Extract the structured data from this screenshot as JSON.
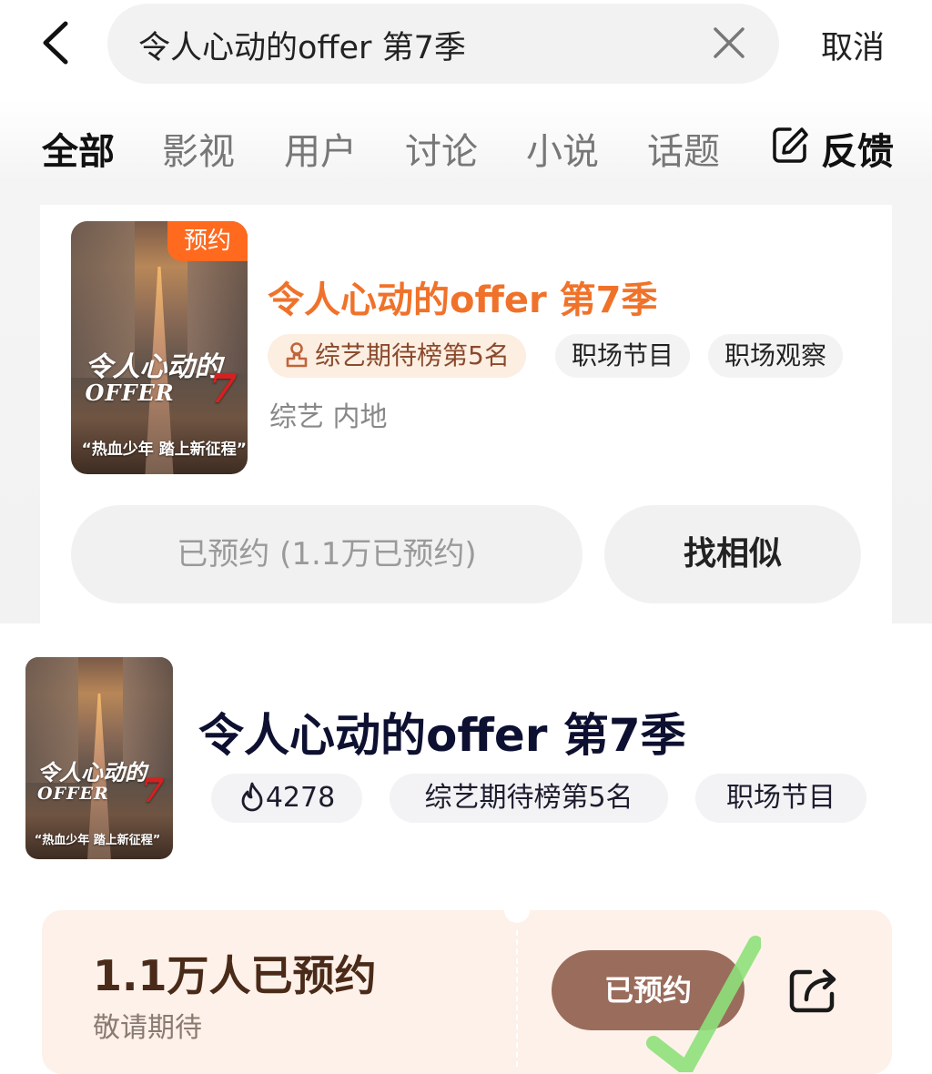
{
  "search": {
    "query": "令人心动的offer 第7季",
    "cancel_label": "取消"
  },
  "tabs": [
    {
      "label": "全部",
      "active": true
    },
    {
      "label": "影视"
    },
    {
      "label": "用户"
    },
    {
      "label": "讨论"
    },
    {
      "label": "小说"
    },
    {
      "label": "话题"
    }
  ],
  "feedback_label": "反馈",
  "card1": {
    "poster": {
      "badge": "预约",
      "logo_cn": "令人心动的",
      "logo_en": "OFFER",
      "logo_num": "7",
      "slogan": "“热血少年  踏上新征程”"
    },
    "title": "令人心动的offer 第7季",
    "tags": [
      "综艺期待榜第5名",
      "职场节目",
      "职场观察"
    ],
    "meta": "综艺 内地",
    "reserved_button": "已预约 (1.1万已预约)",
    "similar_button": "找相似"
  },
  "section2": {
    "poster": {
      "logo_cn": "令人心动的",
      "logo_en": "OFFER",
      "logo_num": "7",
      "slogan": "“热血少年  踏上新征程”"
    },
    "title": "令人心动的offer 第7季",
    "heat": "4278",
    "tags": [
      "综艺期待榜第5名",
      "职场节目"
    ]
  },
  "ticket": {
    "count": "1.1万人已预约",
    "sub": "敬请期待",
    "button": "已预约"
  },
  "colors": {
    "accent_orange": "#f0722a",
    "badge": "#ff6a1f",
    "ticket_bg": "#fdf1ea",
    "ticket_button": "#9a6c5c",
    "check_green": "#8ee07a"
  }
}
